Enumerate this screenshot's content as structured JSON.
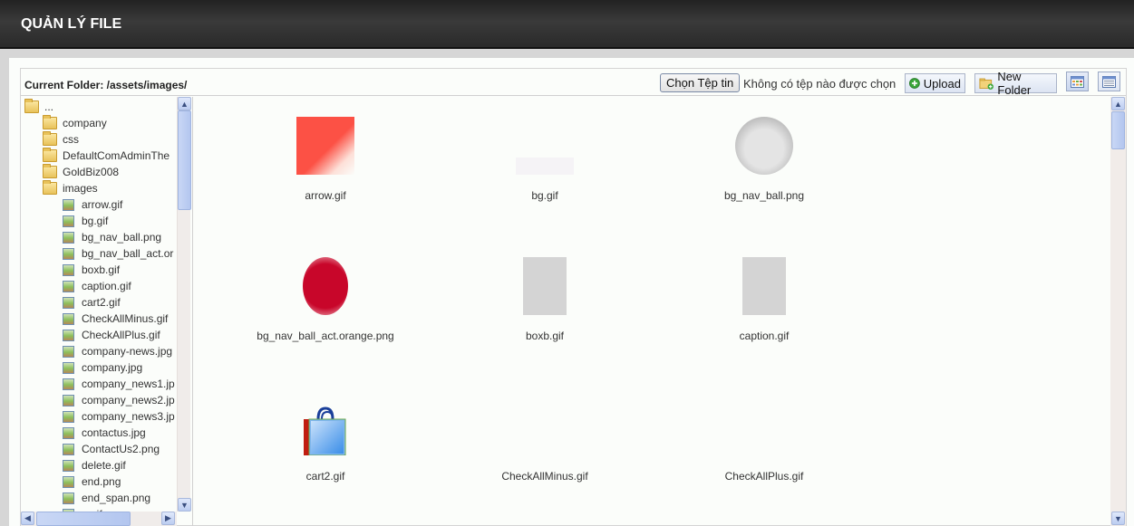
{
  "header": {
    "title": "QUẢN LÝ FILE"
  },
  "toolbar": {
    "current_folder": "Current Folder: /assets/images/",
    "choose_file_label": "Chọn Tệp tin",
    "no_file_text": "Không có tệp nào được chọn",
    "upload_label": "Upload",
    "new_folder_label": "New Folder",
    "view_thumbnails_icon": "grid-view-icon",
    "view_list_icon": "list-view-icon"
  },
  "tree": {
    "root_label": "...",
    "folders": [
      {
        "label": "company"
      },
      {
        "label": "css"
      },
      {
        "label": "DefaultComAdminThe"
      },
      {
        "label": "GoldBiz008"
      },
      {
        "label": "images",
        "open": true
      }
    ],
    "files": [
      {
        "label": "arrow.gif"
      },
      {
        "label": "bg.gif"
      },
      {
        "label": "bg_nav_ball.png"
      },
      {
        "label": "bg_nav_ball_act.or"
      },
      {
        "label": "boxb.gif"
      },
      {
        "label": "caption.gif"
      },
      {
        "label": "cart2.gif"
      },
      {
        "label": "CheckAllMinus.gif"
      },
      {
        "label": "CheckAllPlus.gif"
      },
      {
        "label": "company-news.jpg"
      },
      {
        "label": "company.jpg"
      },
      {
        "label": "company_news1.jp"
      },
      {
        "label": "company_news2.jp"
      },
      {
        "label": "company_news3.jp"
      },
      {
        "label": "contactus.jpg"
      },
      {
        "label": "ContactUs2.png"
      },
      {
        "label": "delete.gif"
      },
      {
        "label": "end.png"
      },
      {
        "label": "end_span.png"
      },
      {
        "label": "...gif"
      }
    ]
  },
  "grid": {
    "items": [
      {
        "name": "arrow.gif",
        "thumb": "arrow"
      },
      {
        "name": "bg.gif",
        "thumb": "bg"
      },
      {
        "name": "bg_nav_ball.png",
        "thumb": "ball"
      },
      {
        "name": "bg_nav_ball_act.orange.png",
        "thumb": "ballact"
      },
      {
        "name": "boxb.gif",
        "thumb": "box"
      },
      {
        "name": "caption.gif",
        "thumb": "box"
      },
      {
        "name": "cart2.gif",
        "thumb": "bag"
      },
      {
        "name": "CheckAllMinus.gif",
        "thumb": "none"
      },
      {
        "name": "CheckAllPlus.gif",
        "thumb": "none"
      }
    ]
  },
  "colors": {
    "header_bg": "#2b2b2b",
    "page_bg": "#d6d6d6",
    "panel_bg": "#fbfdfa",
    "scroll_thumb": "#b3c6ef"
  }
}
